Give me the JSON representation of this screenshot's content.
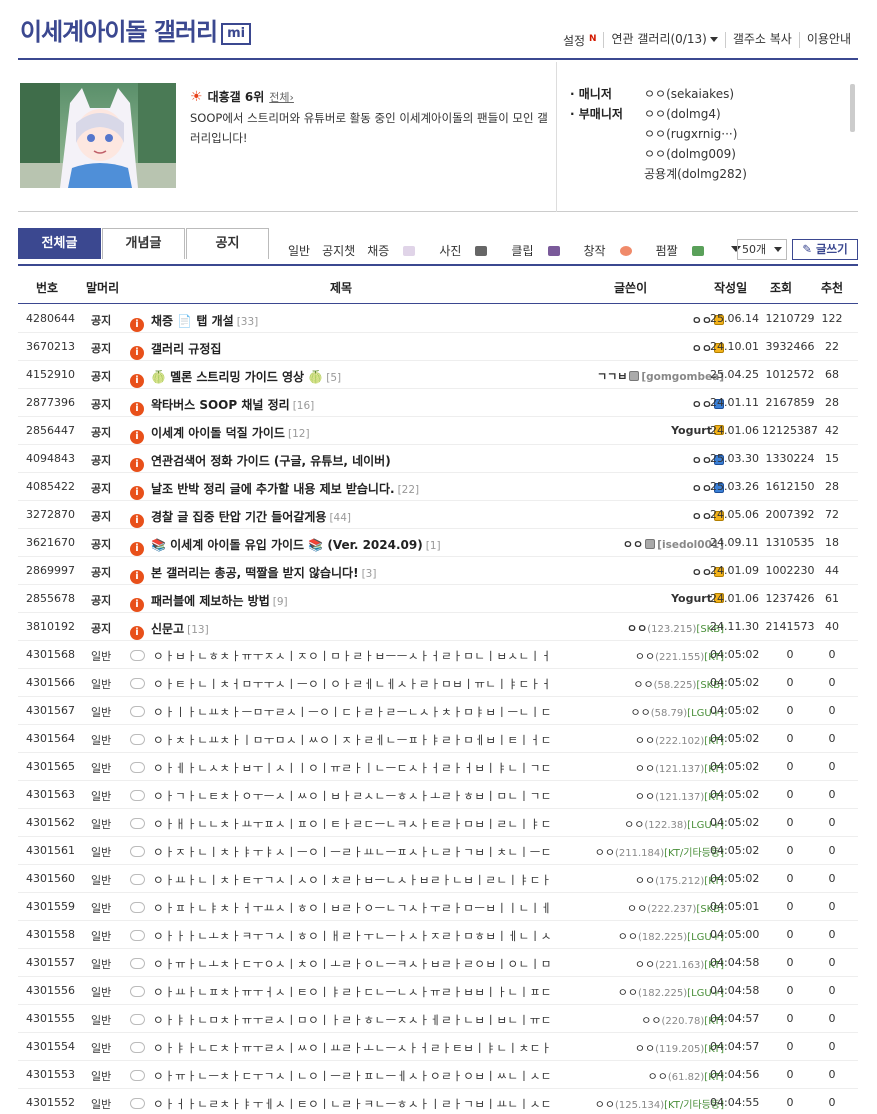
{
  "header": {
    "title": "이세계아이돌 갤러리",
    "badge": "mi",
    "links": {
      "settings": "설정",
      "settings_new": "N",
      "related": "연관 갤러리(0/13)",
      "copy": "갤주소 복사",
      "guide": "이용안내"
    }
  },
  "info": {
    "rank_label": "대흥갤",
    "rank": "6위",
    "rank_all": "전체",
    "description": "SOOP에서 스트리머와 유튜버로 활동 중인 이세계아이돌의 팬들이 모인 갤러리입니다!",
    "manager_label": "매니저",
    "sub_manager_label": "부매니저",
    "manager": "ㅇㅇ(sekaiakes)",
    "sub_managers": [
      "ㅇㅇ(dolmg4)",
      "ㅇㅇ(rugxrnig···)",
      "ㅇㅇ(dolmg009)",
      "공용계(dolmg282)"
    ]
  },
  "tabs": [
    "전체글",
    "개념글",
    "공지"
  ],
  "subcats": [
    "일반",
    "공지챗",
    "채증",
    "사진",
    "클립",
    "창작",
    "펌짤"
  ],
  "list_count": "50개",
  "write_label": "글쓰기",
  "columns": {
    "num": "번호",
    "head": "말머리",
    "title": "제목",
    "writer": "글쓴이",
    "date": "작성일",
    "views": "조회",
    "recs": "추천"
  },
  "notices": [
    {
      "num": "4280644",
      "head": "공지",
      "title": "채증 📄 탭 개설",
      "cmt": "[33]",
      "writer": "ㅇㅇ",
      "badge": "y",
      "gid": "",
      "date": "25.06.14",
      "views": "1210729",
      "recs": "122"
    },
    {
      "num": "3670213",
      "head": "공지",
      "title": "갤러리 규정집",
      "cmt": "",
      "writer": "ㅇㅇ",
      "badge": "y",
      "gid": "",
      "date": "24.10.01",
      "views": "3932466",
      "recs": "22"
    },
    {
      "num": "4152910",
      "head": "공지",
      "title": "🍈 멜론 스트리밍 가이드 영상 🍈",
      "cmt": "[5]",
      "writer": "ㄱㄱㅂ",
      "badge": "g",
      "gid": "[gomgombea]",
      "date": "25.04.25",
      "views": "1012572",
      "recs": "68"
    },
    {
      "num": "2877396",
      "head": "공지",
      "title": "왁타버스 SOOP 채널 정리",
      "cmt": "[16]",
      "writer": "ㅇㅇ",
      "badge": "b",
      "gid": "",
      "date": "24.01.11",
      "views": "2167859",
      "recs": "28"
    },
    {
      "num": "2856447",
      "head": "공지",
      "title": "이세계 아이돌 덕질 가이드",
      "cmt": "[12]",
      "writer": "Yogurt",
      "badge": "y",
      "gid": "",
      "date": "24.01.06",
      "views": "12125387",
      "recs": "42"
    },
    {
      "num": "4094843",
      "head": "공지",
      "title": "연관검색어 정화 가이드 (구글, 유튜브, 네이버)",
      "cmt": "",
      "writer": "ㅇㅇ",
      "badge": "b",
      "gid": "",
      "date": "25.03.30",
      "views": "1330224",
      "recs": "15"
    },
    {
      "num": "4085422",
      "head": "공지",
      "title": "날조 반박 정리 글에 추가할 내용 제보 받습니다.",
      "cmt": "[22]",
      "writer": "ㅇㅇ",
      "badge": "b",
      "gid": "",
      "date": "25.03.26",
      "views": "1612150",
      "recs": "28"
    },
    {
      "num": "3272870",
      "head": "공지",
      "title": "경찰 글 집중 탄압 기간 들어갈게용",
      "cmt": "[44]",
      "writer": "ㅇㅇ",
      "badge": "y",
      "gid": "",
      "date": "24.05.06",
      "views": "2007392",
      "recs": "72"
    },
    {
      "num": "3621670",
      "head": "공지",
      "title": "📚 이세계 아이돌 유입 가이드 📚 (Ver. 2024.09)",
      "cmt": "[1]",
      "writer": "ㅇㅇ",
      "badge": "g",
      "gid": "[isedol001]",
      "date": "24.09.11",
      "views": "1310535",
      "recs": "18"
    },
    {
      "num": "2869997",
      "head": "공지",
      "title": "본 갤러리는 총공, 떡짤을 받지 않습니다!",
      "cmt": "[3]",
      "writer": "ㅇㅇ",
      "badge": "y",
      "gid": "",
      "date": "24.01.09",
      "views": "1002230",
      "recs": "44"
    },
    {
      "num": "2855678",
      "head": "공지",
      "title": "패러블에 제보하는 방법",
      "cmt": "[9]",
      "writer": "Yogurt",
      "badge": "y",
      "gid": "",
      "date": "24.01.06",
      "views": "1237426",
      "recs": "61"
    },
    {
      "num": "3810192",
      "head": "공지",
      "title": "신문고",
      "cmt": "[13]",
      "writer": "ㅇㅇ",
      "badge": "",
      "gid": "",
      "ip": "(123.215)",
      "isp": "[SKB]",
      "date": "24.11.30",
      "views": "2141573",
      "recs": "40"
    }
  ],
  "posts": [
    {
      "num": "4301568",
      "head": "일반",
      "title": "ㅇㅏㅂㅏㄴㅎㅊㅏㅠㅜㅈㅅㅣㅈㅇㅣㅁㅏㄹㅏㅂㅡㅡㅅㅏㅓㄹㅏㅁㄴㅣㅂㅅㄴㅣㅓㄷㅏㅌ",
      "writer": "ㅇㅇ",
      "ip": "(221.155)",
      "isp": "[KT]",
      "date": "04:05:02",
      "views": "0",
      "recs": "0"
    },
    {
      "num": "4301566",
      "head": "일반",
      "title": "ㅇㅏㅌㅏㄴㅣㅊㅓㅁㅜㅜㅅㅣㅡㅇㅣㅇㅏㄹㅔㄴㅔㅅㅏㄹㅏㅁㅂㅣㅠㄴㅣㅑㄷㅏㅓ",
      "writer": "ㅇㅇ",
      "ip": "(58.225)",
      "isp": "[SKB]",
      "date": "04:05:02",
      "views": "0",
      "recs": "0"
    },
    {
      "num": "4301567",
      "head": "일반",
      "title": "ㅇㅏㅣㅏㄴㅛㅊㅏㅡㅁㅜㄹㅅㅣㅡㅇㅣㄷㅏㄹㅏㄹㅡㄴㅅㅏㅊㅏㅁㅑㅂㅣㅡㄴㅣㄷㅏㅠ",
      "writer": "ㅇㅇ",
      "ip": "(58.79)",
      "isp": "[LGU+]",
      "date": "04:05:02",
      "views": "0",
      "recs": "0"
    },
    {
      "num": "4301564",
      "head": "일반",
      "title": "ㅇㅏㅊㅏㄴㅛㅊㅏㅣㅁㅜㅁㅅㅣㅆㅇㅣㅈㅏㄹㅔㄴㅡㅍㅏㅑㄹㅏㅁㅔㅂㅣㅌㅣㅓㄷㅏㄹ",
      "writer": "ㅇㅇ",
      "ip": "(222.102)",
      "isp": "[KT]",
      "date": "04:05:02",
      "views": "0",
      "recs": "0"
    },
    {
      "num": "4301565",
      "head": "일반",
      "title": "ㅇㅏㅔㅏㄴㅅㅊㅏㅂㅜㅣㅅㅣㅣㅇㅣㅠㄹㅏㅣㄴㅡㄷㅅㅏㅓㄹㅏㅓㅂㅣㅑㄴㅣㄱㄷㅏㄷ",
      "writer": "ㅇㅇ",
      "ip": "(121.137)",
      "isp": "[KT]",
      "date": "04:05:02",
      "views": "0",
      "recs": "0"
    },
    {
      "num": "4301563",
      "head": "일반",
      "title": "ㅇㅏㄱㅏㄴㅌㅊㅏㅇㅜㅡㅅㅣㅆㅇㅣㅂㅏㄹㅅㄴㅡㅎㅅㅏㅗㄹㅏㅎㅂㅣㅁㄴㅣㄱㄷㅏㄷ",
      "writer": "ㅇㅇ",
      "ip": "(121.137)",
      "isp": "[KT]",
      "date": "04:05:02",
      "views": "0",
      "recs": "0"
    },
    {
      "num": "4301562",
      "head": "일반",
      "title": "ㅇㅏㅐㅏㄴㄴㅊㅏㅛㅜㅍㅅㅣㅍㅇㅣㅌㅏㄹㄷㅡㄴㅋㅅㅏㅌㄹㅏㅁㅂㅣㄹㄴㅣㅑㄷㅏㅅ",
      "writer": "ㅇㅇ",
      "ip": "(122.38)",
      "isp": "[LGU+]",
      "date": "04:05:02",
      "views": "0",
      "recs": "0"
    },
    {
      "num": "4301561",
      "head": "일반",
      "title": "ㅇㅏㅈㅏㄴㅣㅊㅏㅑㅜㅑㅅㅣㅡㅇㅣㅡㄹㅏㅛㄴㅡㅍㅅㅏㄴㄹㅏㄱㅂㅣㅊㄴㅣㅡㄷㅏㅜ",
      "writer": "ㅇㅇ",
      "ip": "(211.184)",
      "isp": "[KT/기타등등]",
      "date": "04:05:02",
      "views": "0",
      "recs": "0"
    },
    {
      "num": "4301560",
      "head": "일반",
      "title": "ㅇㅏㅛㅏㄴㅣㅊㅏㅌㅜㄱㅅㅣㅅㅇㅣㅊㄹㅏㅂㅡㄴㅅㅏㅂㄹㅏㄴㅂㅣㄹㄴㅣㅑㄷㅏㅏ",
      "writer": "ㅇㅇ",
      "ip": "(175.212)",
      "isp": "[KT]",
      "date": "04:05:02",
      "views": "0",
      "recs": "0"
    },
    {
      "num": "4301559",
      "head": "일반",
      "title": "ㅇㅏㅍㅏㄴㅑㅊㅏㅓㅜㅛㅅㅣㅎㅇㅣㅂㄹㅏㅇㅡㄴㄱㅅㅏㅜㄹㅏㅁㅡㅂㅣㅣㄴㅣㅔㄷㅏㅔ",
      "writer": "ㅇㅇ",
      "ip": "(222.237)",
      "isp": "[SKB]",
      "date": "04:05:01",
      "views": "0",
      "recs": "0"
    },
    {
      "num": "4301558",
      "head": "일반",
      "title": "ㅇㅏㅏㅏㄴㅗㅊㅏㅋㅜㄱㅅㅣㅎㅇㅣㅐㄹㅏㅜㄴㅡㅏㅅㅏㅈㄹㅏㅁㅎㅂㅣㅔㄴㅣㅅㄷㅏㅣ",
      "writer": "ㅇㅇ",
      "ip": "(182.225)",
      "isp": "[LGU+]",
      "date": "04:05:00",
      "views": "0",
      "recs": "0"
    },
    {
      "num": "4301557",
      "head": "일반",
      "title": "ㅇㅏㅠㅏㄴㅗㅊㅏㄷㅜㅇㅅㅣㅊㅇㅣㅗㄹㅏㅇㄴㅡㅋㅅㅏㅂㄹㅏㄹㅇㅂㅣㅇㄴㅣㅁㄷㅏㅓ",
      "writer": "ㅇㅇ",
      "ip": "(221.163)",
      "isp": "[KT]",
      "date": "04:04:58",
      "views": "0",
      "recs": "0"
    },
    {
      "num": "4301556",
      "head": "일반",
      "title": "ㅇㅏㅛㅏㄴㅍㅊㅏㅠㅜㅓㅅㅣㅌㅇㅣㅑㄹㅏㄷㄴㅡㄴㅅㅏㅠㄹㅏㅂㅂㅣㅏㄴㅣㅍㄷㅏㅗ",
      "writer": "ㅇㅇ",
      "ip": "(182.225)",
      "isp": "[LGU+]",
      "date": "04:04:58",
      "views": "0",
      "recs": "0"
    },
    {
      "num": "4301555",
      "head": "일반",
      "title": "ㅇㅏㅑㅏㄴㅁㅊㅏㅠㅜㄹㅅㅣㅁㅇㅣㅏㄹㅏㅎㄴㅡㅈㅅㅏㅔㄹㅏㄴㅂㅣㅂㄴㅣㅠㄷㅏㅛ",
      "writer": "ㅇㅇ",
      "ip": "(220.78)",
      "isp": "[KT]",
      "date": "04:04:57",
      "views": "0",
      "recs": "0"
    },
    {
      "num": "4301554",
      "head": "일반",
      "title": "ㅇㅏㅑㅏㄴㄷㅊㅏㅠㅜㄹㅅㅣㅆㅇㅣㅛㄹㅏㅗㄴㅡㅅㅏㅓㄹㅏㅌㅂㅣㅑㄴㅣㅊㄷㅏㅇ",
      "writer": "ㅇㅇ",
      "ip": "(119.205)",
      "isp": "[KT]",
      "date": "04:04:57",
      "views": "0",
      "recs": "0"
    },
    {
      "num": "4301553",
      "head": "일반",
      "title": "ㅇㅏㅠㅏㄴㅡㅊㅏㄷㅜㄱㅅㅣㄴㅇㅣㅡㄹㅏㅍㄴㅡㅔㅅㅏㅇㄹㅏㅇㅂㅣㅆㄴㅣㅅㄷㅏㅗ",
      "writer": "ㅇㅇ",
      "ip": "(61.82)",
      "isp": "[KT]",
      "date": "04:04:56",
      "views": "0",
      "recs": "0"
    },
    {
      "num": "4301552",
      "head": "일반",
      "title": "ㅇㅏㅓㅏㄴㄹㅊㅏㅑㅜㅔㅅㅣㅌㅇㅣㄴㄹㅏㅋㄴㅡㅎㅅㅏㅣㄹㅏㄱㅂㅣㅛㄴㅣㅅㄷㅏㅓ",
      "writer": "ㅇㅇ",
      "ip": "(125.134)",
      "isp": "[KT/기타등등]",
      "date": "04:04:55",
      "views": "0",
      "recs": "0"
    }
  ]
}
